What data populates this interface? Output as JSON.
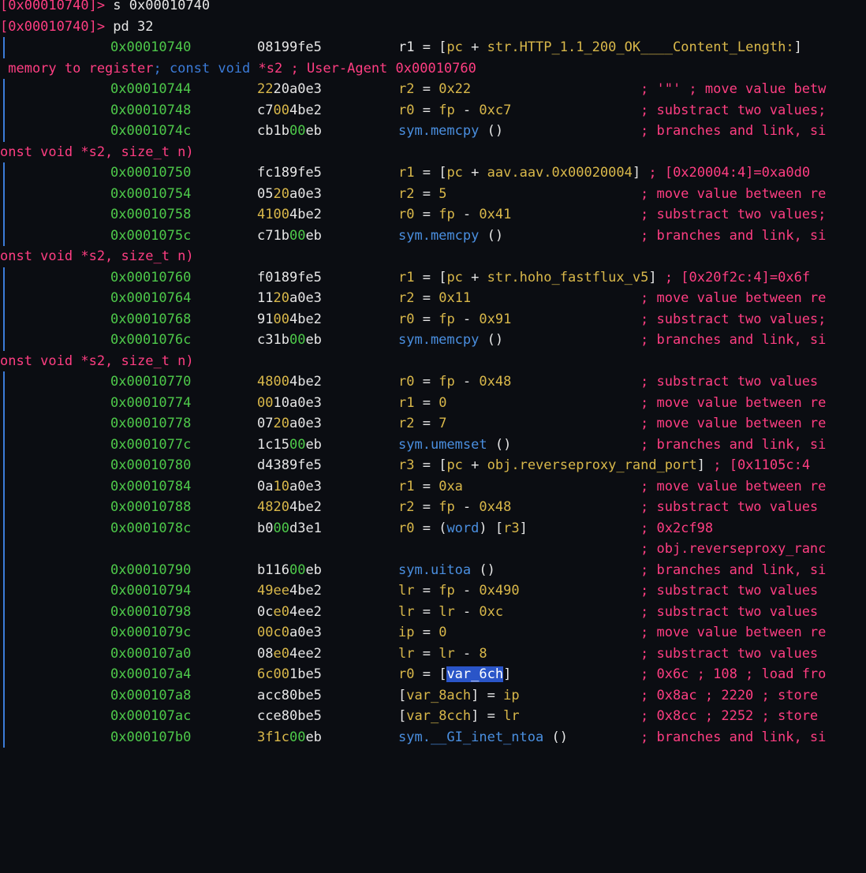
{
  "prompts": [
    {
      "addr": "[0x00010740]>",
      "cmd": " s 0x00010740"
    },
    {
      "addr": "[0x00010740]>",
      "cmd": " pd 32"
    }
  ],
  "rows": [
    {
      "addr": "0x00010740",
      "b1": "08199fe5",
      "b2": "",
      "b3": "",
      "c1": "r1 = [pc + str.HTTP_1.1_200_OK____Content_Length:]",
      "c2": "",
      "c3": "",
      "cm": ""
    },
    {
      "cont": "memory to register; const void *s2 ; User-Agent 0x00010760"
    },
    {
      "addr": "0x00010744",
      "b1": "22",
      "b2": "20",
      "b3": "a0e3",
      "c1": "r2 = 0x22",
      "c2": "",
      "c3": "",
      "cm": "; '\"' ; move value betw"
    },
    {
      "addr": "0x00010748",
      "b1": "c7",
      "b2": "00",
      "b3": "4be2",
      "c1": "r0 = fp - 0xc7",
      "c2": "",
      "c3": "",
      "cm": "; substract two values;"
    },
    {
      "addr": "0x0001074c",
      "b1": "cb1b",
      "b2": "00",
      "b3": "eb",
      "c1": "sym.memcpy ()",
      "c2": "",
      "c3": "",
      "cm": "; branches and link, si"
    },
    {
      "cont": "onst void *s2, size_t n)"
    },
    {
      "addr": "0x00010750",
      "b1": "fc189fe5",
      "b2": "",
      "b3": "",
      "c1": "r1 = [pc + aav.aav.0x00020004]",
      "c2": " ; [0x20004:4]=0xa0d0",
      "c3": "",
      "cm": ""
    },
    {
      "addr": "0x00010754",
      "b1": "05",
      "b2": "20",
      "b3": "a0e3",
      "c1": "r2 = 5",
      "c2": "",
      "c3": "",
      "cm": "; move value between re"
    },
    {
      "addr": "0x00010758",
      "b1": "41",
      "b2": "00",
      "b3": "4be2",
      "c1": "r0 = fp - 0x41",
      "c2": "",
      "c3": "",
      "cm": "; substract two values;"
    },
    {
      "addr": "0x0001075c",
      "b1": "c71b",
      "b2": "00",
      "b3": "eb",
      "c1": "sym.memcpy ()",
      "c2": "",
      "c3": "",
      "cm": "; branches and link, si"
    },
    {
      "cont": "onst void *s2, size_t n)"
    },
    {
      "addr": "0x00010760",
      "b1": "f0189fe5",
      "b2": "",
      "b3": "",
      "c1": "r1 = [pc + str.hoho_fastflux_v5]",
      "c2": " ; [0x20f2c:4]=0x6f",
      "c3": "",
      "cm": ""
    },
    {
      "addr": "0x00010764",
      "b1": "11",
      "b2": "20",
      "b3": "a0e3",
      "c1": "r2 = 0x11",
      "c2": "",
      "c3": "",
      "cm": "; move value between re"
    },
    {
      "addr": "0x00010768",
      "b1": "91",
      "b2": "00",
      "b3": "4be2",
      "c1": "r0 = fp - 0x91",
      "c2": "",
      "c3": "",
      "cm": "; substract two values;"
    },
    {
      "addr": "0x0001076c",
      "b1": "c31b",
      "b2": "00",
      "b3": "eb",
      "c1": "sym.memcpy ()",
      "c2": "",
      "c3": "",
      "cm": "; branches and link, si"
    },
    {
      "cont": "onst void *s2, size_t n)"
    },
    {
      "addr": "0x00010770",
      "b1": "48",
      "b2": "00",
      "b3": "4be2",
      "c1": "r0 = fp - 0x48",
      "c2": "",
      "c3": "",
      "cm": "; substract two values"
    },
    {
      "addr": "0x00010774",
      "b1": "00",
      "b2": "10",
      "b3": "a0e3",
      "c1": "r1 = 0",
      "c2": "",
      "c3": "",
      "cm": "; move value between re"
    },
    {
      "addr": "0x00010778",
      "b1": "07",
      "b2": "20",
      "b3": "a0e3",
      "c1": "r2 = 7",
      "c2": "",
      "c3": "",
      "cm": "; move value between re"
    },
    {
      "addr": "0x0001077c",
      "b1": "1c15",
      "b2": "00",
      "b3": "eb",
      "c1": "sym.umemset ()",
      "c2": "",
      "c3": "",
      "cm": "; branches and link, si"
    },
    {
      "addr": "0x00010780",
      "b1": "d4389fe5",
      "b2": "",
      "b3": "",
      "c1": "r3 = [pc + obj.reverseproxy_rand_port]",
      "c2": " ; [0x1105c:4",
      "c3": "",
      "cm": ""
    },
    {
      "addr": "0x00010784",
      "b1": "0a",
      "b2": "10",
      "b3": "a0e3",
      "c1": "r1 = 0xa",
      "c2": "",
      "c3": "",
      "cm": "; move value between re"
    },
    {
      "addr": "0x00010788",
      "b1": "48",
      "b2": "20",
      "b3": "4be2",
      "c1": "r2 = fp - 0x48",
      "c2": "",
      "c3": "",
      "cm": "; substract two values"
    },
    {
      "addr": "0x0001078c",
      "b1": "b0",
      "b2": "00",
      "b3": "d3e1",
      "c1": "r0 = (word) [r3]",
      "c2": "",
      "c3": "",
      "cm": "; 0x2cf98"
    },
    {
      "cmtonly": "; obj.reverseproxy_ranc"
    },
    {
      "addr": "0x00010790",
      "b1": "b116",
      "b2": "00",
      "b3": "eb",
      "c1": "sym.uitoa ()",
      "c2": "",
      "c3": "",
      "cm": "; branches and link, si"
    },
    {
      "addr": "0x00010794",
      "b1": "49",
      "b2": "ee",
      "b3": "4be2",
      "c1": "lr = fp - 0x490",
      "c2": "",
      "c3": "",
      "cm": "; substract two values"
    },
    {
      "addr": "0x00010798",
      "b1": "0c",
      "b2": "e0",
      "b3": "4ee2",
      "c1": "lr = lr - 0xc",
      "c2": "",
      "c3": "",
      "cm": "; substract two values"
    },
    {
      "addr": "0x0001079c",
      "b1": "00",
      "b2": "c0",
      "b3": "a0e3",
      "c1": "ip = 0",
      "c2": "",
      "c3": "",
      "cm": "; move value between re"
    },
    {
      "addr": "0x000107a0",
      "b1": "08",
      "b2": "e0",
      "b3": "4ee2",
      "c1": "lr = lr - 8",
      "c2": "",
      "c3": "",
      "cm": "; substract two values"
    },
    {
      "addr": "0x000107a4",
      "b1": "6c",
      "b2": "00",
      "b3": "1be5",
      "c1": "r0 = [var_6ch]",
      "c2": "",
      "c3": "",
      "cm": "; 0x6c ; 108 ; load fro"
    },
    {
      "addr": "0x000107a8",
      "b1": "acc8",
      "b2": "0b",
      "b3": "e5",
      "c1": "[var_8ach] = ip",
      "c2": "",
      "c3": "",
      "cm": "; 0x8ac ; 2220 ; store"
    },
    {
      "addr": "0x000107ac",
      "b1": "cce8",
      "b2": "0b",
      "b3": "e5",
      "c1": "[var_8cch] = lr",
      "c2": "",
      "c3": "",
      "cm": "; 0x8cc ; 2252 ; store"
    },
    {
      "addr": "0x000107b0",
      "b1": "3f1c",
      "b2": "00",
      "b3": "eb",
      "c1": "sym.__GI_inet_ntoa ()",
      "c2": "",
      "c3": "",
      "cm": "; branches and link, si"
    }
  ]
}
